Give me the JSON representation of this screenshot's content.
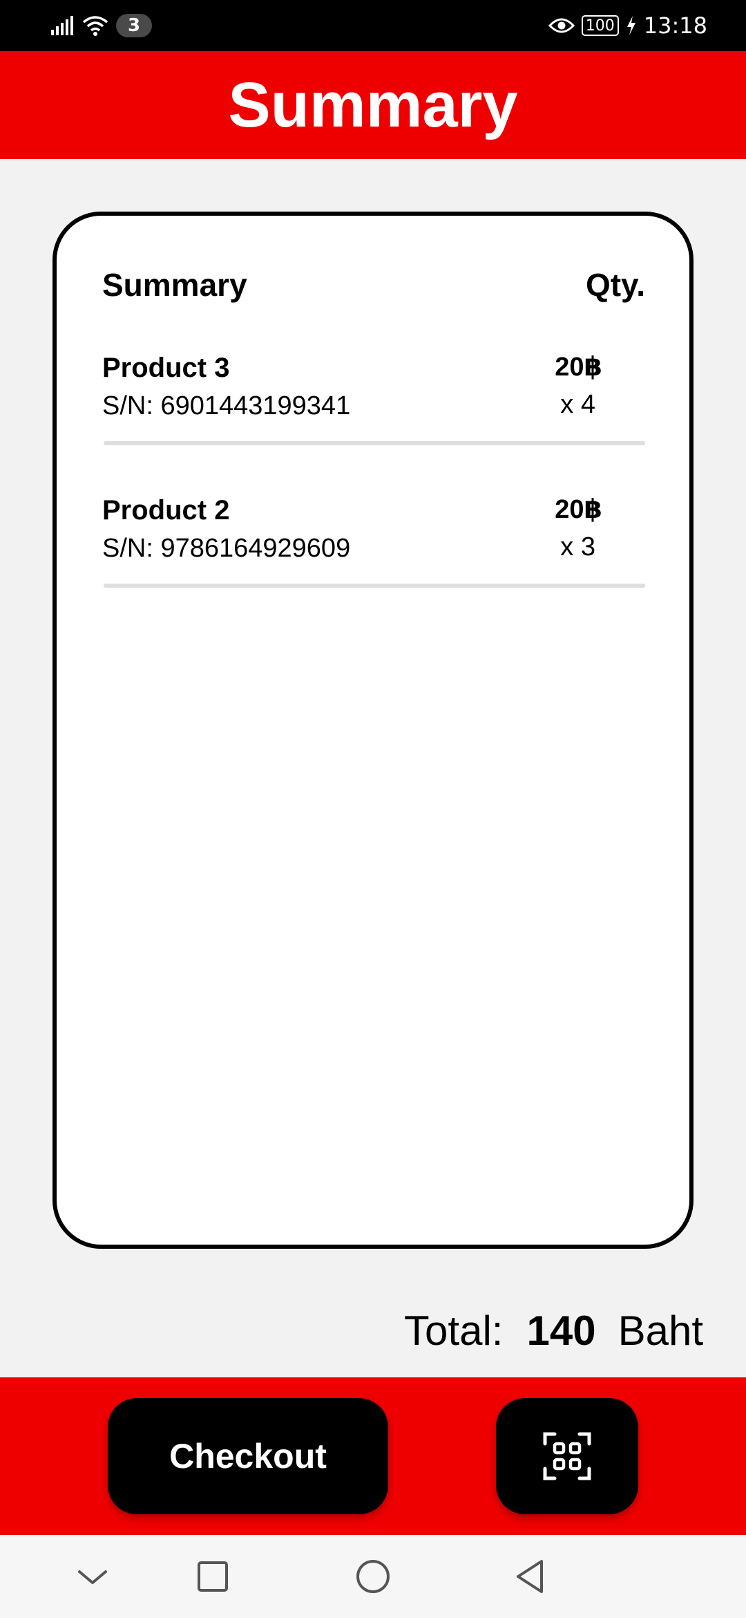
{
  "status_bar": {
    "notification_count": "3",
    "battery": "100",
    "time": "13:18"
  },
  "header": {
    "title": "Summary"
  },
  "card": {
    "col_summary": "Summary",
    "col_qty": "Qty.",
    "items": [
      {
        "name": "Product 3",
        "sn": "S/N: 6901443199341",
        "price": "20฿",
        "qty": "x 4"
      },
      {
        "name": "Product 2",
        "sn": "S/N: 9786164929609",
        "price": "20฿",
        "qty": "x 3"
      }
    ]
  },
  "total": {
    "label": "Total:",
    "value": "140",
    "unit": "Baht"
  },
  "actions": {
    "checkout_label": "Checkout",
    "scan_icon": "qr-scan-icon"
  },
  "nav": {
    "icons": [
      "chevron-down-icon",
      "square-icon",
      "circle-icon",
      "back-triangle-icon"
    ]
  },
  "colors": {
    "accent": "#ee0000",
    "button": "#000000",
    "background": "#f2f2f2"
  }
}
